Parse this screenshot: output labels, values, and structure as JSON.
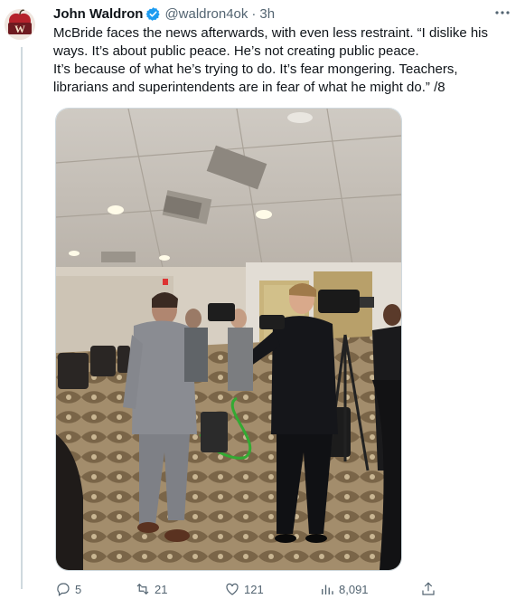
{
  "author": {
    "name": "John Waldron",
    "handle": "@waldron4ok",
    "separator": "·",
    "time": "3h",
    "avatar_letter": "W"
  },
  "tweet": {
    "line1": "McBride faces the news afterwards, with even less restraint. “I dislike his ways. It’s about public peace. He’s not creating public peace.",
    "line2": "It’s because of what he’s trying to do. It’s fear mongering. Teachers, librarians and superintendents are in fear of what he might do.” /8"
  },
  "media": {
    "kind": "photo",
    "scene": "press-scrum-in-conference-room"
  },
  "actions": [
    {
      "icon": "reply-icon",
      "count": "5"
    },
    {
      "icon": "retweet-icon",
      "count": "21"
    },
    {
      "icon": "like-icon",
      "count": "121"
    },
    {
      "icon": "views-icon",
      "count": "8,091"
    },
    {
      "icon": "share-icon",
      "count": ""
    }
  ],
  "colors": {
    "text": "#0f1419",
    "secondary": "#536471",
    "verified": "#1d9bf0",
    "line": "#cfd9de"
  }
}
